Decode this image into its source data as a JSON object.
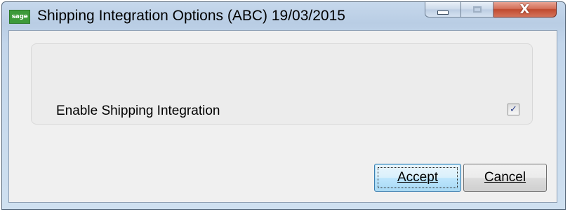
{
  "window": {
    "icon_text": "sage",
    "title": "Shipping Integration Options (ABC) 19/03/2015",
    "controls": {
      "minimize_icon": "minimize-icon",
      "maximize_icon": "maximize-icon",
      "close_symbol": "X"
    }
  },
  "options": {
    "enable_shipping_integration": {
      "label": "Enable Shipping Integration",
      "checked": true,
      "check_symbol": "✓"
    }
  },
  "buttons": {
    "accept_label": "Accept",
    "cancel_label": "Cancel"
  },
  "colors": {
    "title_bar": "#b9cde4",
    "close_button": "#c04a2f",
    "accept_button_border": "#3c7fb1",
    "app_icon": "#3d9a3a"
  }
}
